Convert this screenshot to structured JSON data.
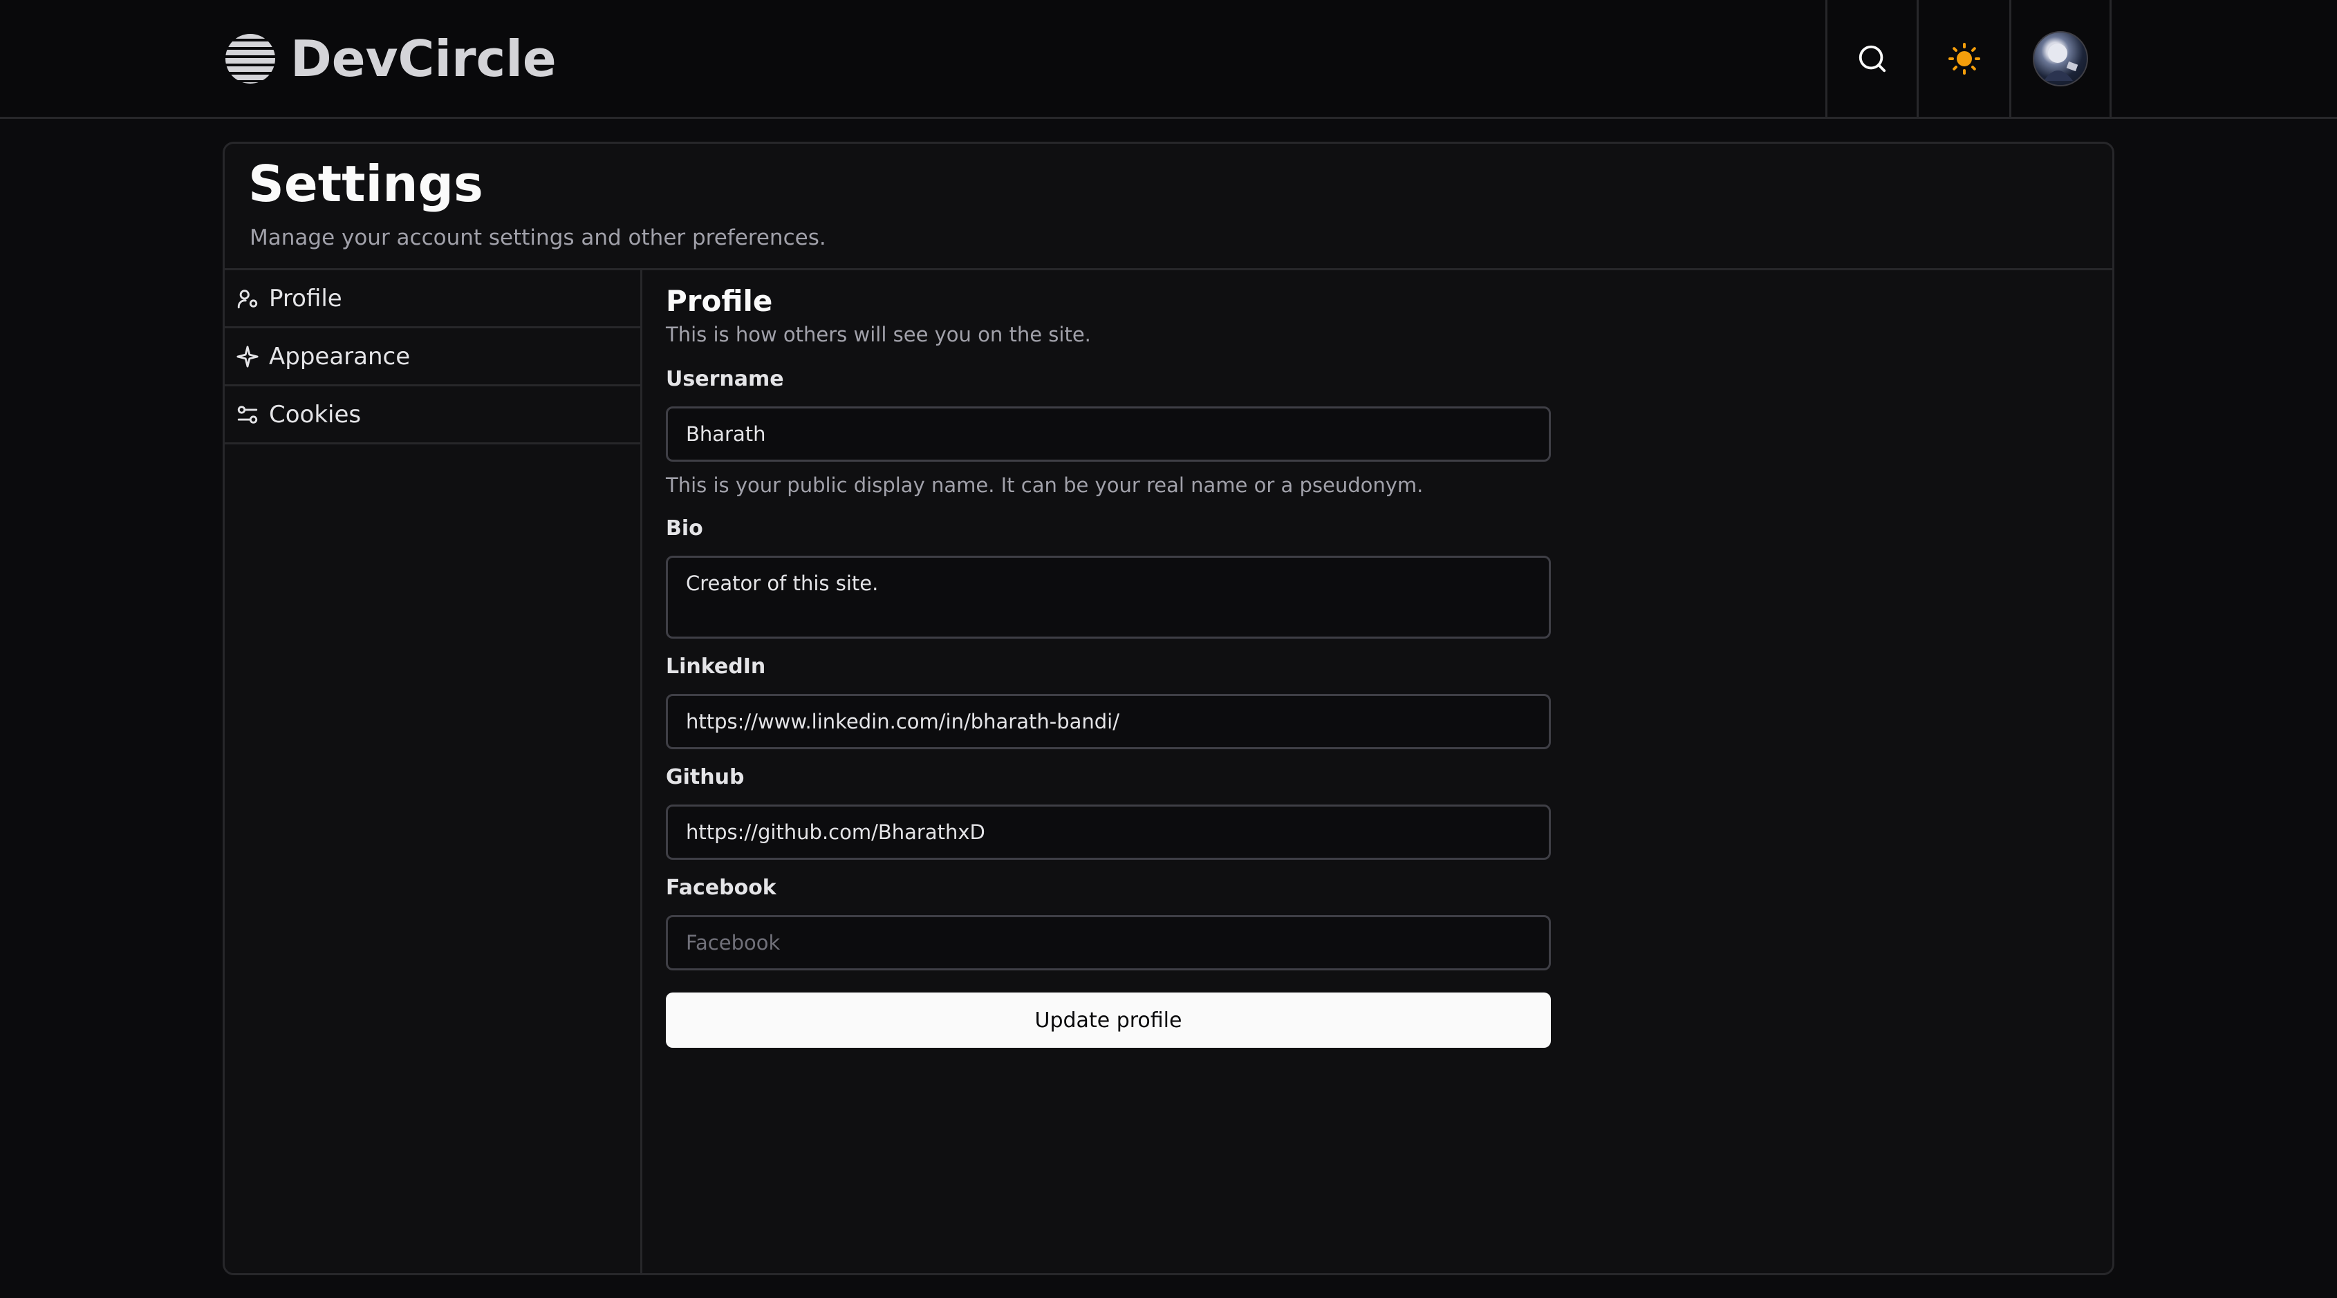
{
  "header": {
    "brand_name": "DevCircle",
    "search_icon": "search-icon",
    "theme_icon": "sun-icon",
    "accent_sun": "#f59e0b"
  },
  "page": {
    "title": "Settings",
    "description": "Manage your account settings and other preferences."
  },
  "sidebar": {
    "items": [
      {
        "label": "Profile",
        "icon": "user-icon"
      },
      {
        "label": "Appearance",
        "icon": "sparkle-icon"
      },
      {
        "label": "Cookies",
        "icon": "sliders-icon"
      }
    ]
  },
  "profile": {
    "title": "Profile",
    "description": "This is how others will see you on the site.",
    "username": {
      "label": "Username",
      "value": "Bharath",
      "hint": "This is your public display name. It can be your real name or a pseudonym."
    },
    "bio": {
      "label": "Bio",
      "value": "Creator of this site."
    },
    "linkedin": {
      "label": "LinkedIn",
      "value": "https://www.linkedin.com/in/bharath-bandi/"
    },
    "github": {
      "label": "Github",
      "value": "https://github.com/BharathxD"
    },
    "facebook": {
      "label": "Facebook",
      "value": "",
      "placeholder": "Facebook"
    },
    "submit_label": "Update profile"
  }
}
